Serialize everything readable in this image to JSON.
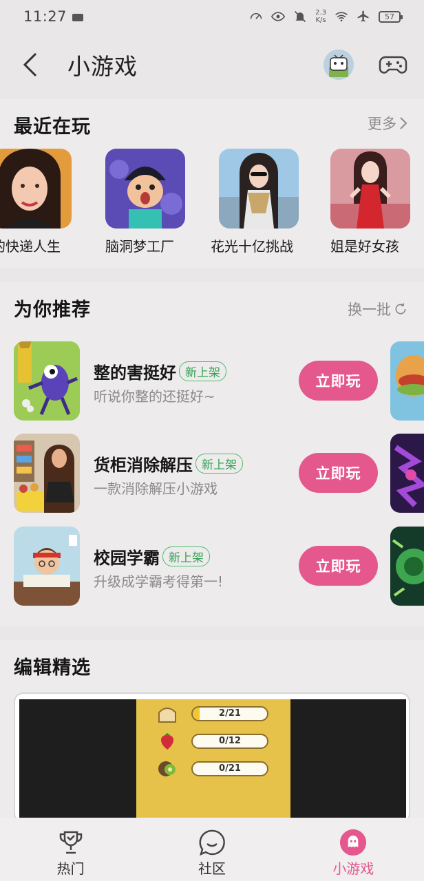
{
  "status_bar": {
    "time": "11:27",
    "net_speed_value": "2.3",
    "net_speed_unit": "K/s",
    "battery": "57"
  },
  "header": {
    "title": "小游戏"
  },
  "recent": {
    "title": "最近在玩",
    "more_label": "更多",
    "items": [
      {
        "name": "的快递人生"
      },
      {
        "name": "脑洞梦工厂"
      },
      {
        "name": "花光十亿挑战"
      },
      {
        "name": "姐是好女孩"
      }
    ]
  },
  "recommend": {
    "title": "为你推荐",
    "refresh_label": "换一批",
    "items": [
      {
        "name": "整的害挺好",
        "tag": "新上架",
        "desc": "听说你整的还挺好~",
        "play": "立即玩"
      },
      {
        "name": "货柜消除解压",
        "tag": "新上架",
        "desc": "一款消除解压小游戏",
        "play": "立即玩"
      },
      {
        "name": "校园学霸",
        "tag": "新上架",
        "desc": "升级成学霸考得第一!",
        "play": "立即玩"
      }
    ]
  },
  "editor": {
    "title": "编辑精选",
    "progress": [
      {
        "text": "2/21",
        "fraction": 0.095,
        "icon": "bread-icon"
      },
      {
        "text": "0/12",
        "fraction": 0,
        "icon": "strawberry-icon"
      },
      {
        "text": "0/21",
        "fraction": 0,
        "icon": "kiwi-icon"
      }
    ]
  },
  "nav": {
    "tabs": [
      {
        "label": "热门",
        "icon": "trophy-icon"
      },
      {
        "label": "社区",
        "icon": "chat-smile-icon"
      },
      {
        "label": "小游戏",
        "icon": "ghost-icon",
        "active": true
      }
    ]
  },
  "colors": {
    "accent": "#e4588d",
    "tag_green": "#34a454",
    "background": "#e9e7e8"
  }
}
